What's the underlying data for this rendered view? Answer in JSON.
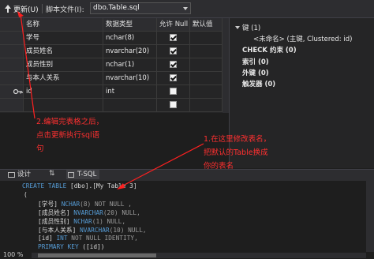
{
  "toolbar": {
    "update_label": "更新(U)",
    "script_label": "脚本文件(I):",
    "script_file": "dbo.Table.sql"
  },
  "grid": {
    "headers": [
      "名称",
      "数据类型",
      "允许 Null",
      "默认值"
    ],
    "rows": [
      {
        "name": "学号",
        "type": "nchar(8)",
        "allow_null": true
      },
      {
        "name": "成员姓名",
        "type": "nvarchar(20)",
        "allow_null": true
      },
      {
        "name": "成员性别",
        "type": "nchar(1)",
        "allow_null": true
      },
      {
        "name": "与本人关系",
        "type": "nvarchar(10)",
        "allow_null": true
      },
      {
        "name": "id",
        "type": "int",
        "allow_null": false,
        "primary_key": true
      }
    ]
  },
  "props": {
    "keys": "键 (1)",
    "key_item": "<未命名> (主键, Clustered: id)",
    "check": "CHECK 约束 (0)",
    "index": "索引 (0)",
    "fk": "外键 (0)",
    "trigger": "触发器 (0)"
  },
  "tabs": {
    "design": "设计",
    "tsql": "T-SQL"
  },
  "sql": {
    "l1_kw": "CREATE TABLE",
    "l1_rest": " [dbo].[My Table 3]",
    "l2": "(",
    "l3_col": "[学号]",
    "l3_type": "NCHAR",
    "l3_rest": "(8) NOT NULL ,",
    "l4_col": "[成员姓名]",
    "l4_type": "NVARCHAR",
    "l4_rest": "(20) NULL,",
    "l5_col": "[成员性别]",
    "l5_type": "NCHAR",
    "l5_rest": "(1) NULL,",
    "l6_col": "[与本人关系]",
    "l6_type": "NVARCHAR",
    "l6_rest": "(10) NULL,",
    "l7_col": "[id]",
    "l7_type": "INT",
    "l7_rest": " NOT NULL IDENTITY,",
    "l8_kw": "PRIMARY KEY",
    "l8_rest": " ([id])"
  },
  "zoom": "100 %",
  "annotations": {
    "a1": [
      "1.在这里修改表名，",
      "把默认的Table换成",
      "你的表名"
    ],
    "a2": [
      "2.编辑完表格之后，",
      "点击更新执行sql语",
      "句"
    ]
  },
  "colors": {
    "annotation": "#ff2020",
    "keyword": "#569cd6",
    "background": "#1e1e1e"
  }
}
